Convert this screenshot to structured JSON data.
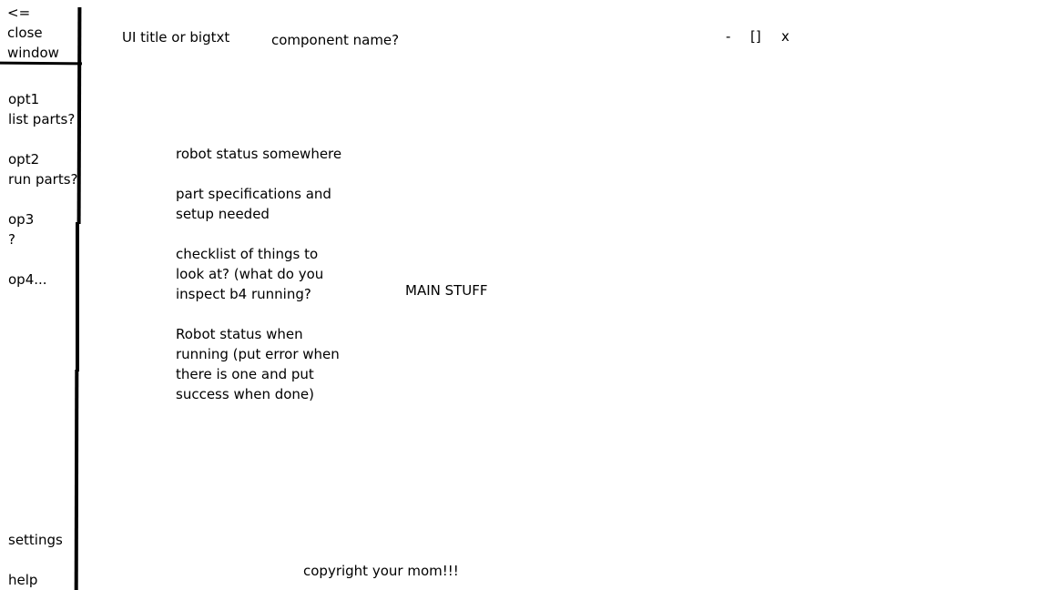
{
  "close": {
    "lines": [
      "<=",
      "close",
      "window"
    ]
  },
  "header": {
    "title": "UI title or bigtxt",
    "component": "component name?",
    "minimize": "-",
    "maximize": "[]",
    "close": "x"
  },
  "sidebar": {
    "items": [
      {
        "line1": "opt1",
        "line2": "list parts?"
      },
      {
        "line1": "opt2",
        "line2": "run parts?"
      },
      {
        "line1": "op3",
        "line2": "?"
      },
      {
        "line1": "op4...",
        "line2": ""
      }
    ],
    "settings": "settings",
    "help": "help"
  },
  "main": {
    "robot_status": "robot status somewhere",
    "part_specs": [
      "part specifications and",
      "setup needed"
    ],
    "checklist": [
      "checklist of things to",
      "look at? (what do you",
      "inspect b4 running?"
    ],
    "robot_running": [
      "Robot status when",
      "running (put error when",
      "there is one and put",
      "success when done)"
    ],
    "main_stuff": "MAIN STUFF"
  },
  "footer": {
    "copyright": "copyright your mom!!!"
  }
}
